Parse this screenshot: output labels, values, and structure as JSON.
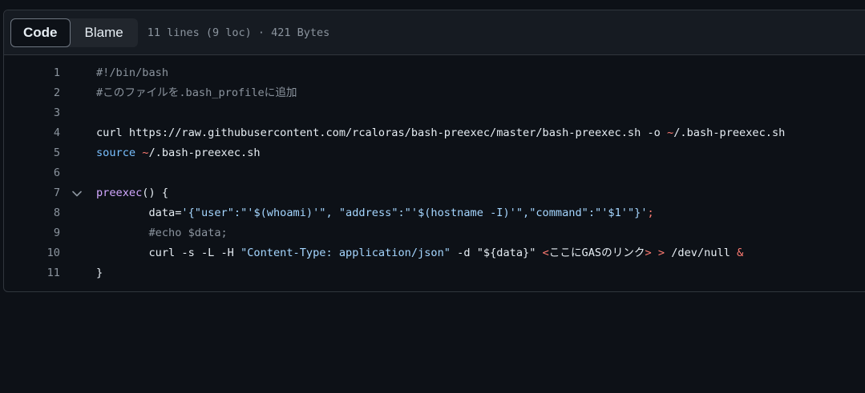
{
  "header": {
    "code_label": "Code",
    "blame_label": "Blame",
    "meta": "11 lines (9 loc) · 421 Bytes"
  },
  "colors": {
    "background": "#0d1117",
    "header_background": "#161b22",
    "border": "#30363d",
    "comment": "#8b949e",
    "string": "#a5d6ff",
    "builtin": "#79c0ff",
    "function": "#d2a8ff",
    "operator": "#ff7b72",
    "text": "#e6edf3"
  },
  "icons": {
    "fold": "chevron-down-icon"
  },
  "lines": [
    {
      "number": "1",
      "tokens": [
        {
          "t": "#!/bin/bash",
          "c": "comment"
        }
      ]
    },
    {
      "number": "2",
      "tokens": [
        {
          "t": "#このファイルを.bash_profileに追加",
          "c": "comment"
        }
      ]
    },
    {
      "number": "3",
      "tokens": []
    },
    {
      "number": "4",
      "tokens": [
        {
          "t": "curl https://raw.githubusercontent.com/rcaloras/bash-preexec/master/bash-preexec.sh -o ",
          "c": "plain"
        },
        {
          "t": "~",
          "c": "op"
        },
        {
          "t": "/.bash-preexec.sh",
          "c": "plain"
        }
      ]
    },
    {
      "number": "5",
      "tokens": [
        {
          "t": "source",
          "c": "builtin"
        },
        {
          "t": " ",
          "c": "plain"
        },
        {
          "t": "~",
          "c": "op"
        },
        {
          "t": "/.bash-preexec.sh",
          "c": "plain"
        }
      ]
    },
    {
      "number": "6",
      "tokens": []
    },
    {
      "number": "7",
      "fold": true,
      "tokens": [
        {
          "t": "preexec",
          "c": "func"
        },
        {
          "t": "() {",
          "c": "plain"
        }
      ]
    },
    {
      "number": "8",
      "tokens": [
        {
          "t": "        data=",
          "c": "plain"
        },
        {
          "t": "'{\"user\":\"'",
          "c": "string"
        },
        {
          "t": "$(whoami)",
          "c": "string"
        },
        {
          "t": "'\", \"address\":\"'",
          "c": "string"
        },
        {
          "t": "$(hostname -I)",
          "c": "string"
        },
        {
          "t": "'\",\"command\":\"'",
          "c": "string"
        },
        {
          "t": "$1",
          "c": "string"
        },
        {
          "t": "'\"}'",
          "c": "string"
        },
        {
          "t": ";",
          "c": "op"
        }
      ]
    },
    {
      "number": "9",
      "tokens": [
        {
          "t": "        #echo $data;",
          "c": "comment"
        }
      ]
    },
    {
      "number": "10",
      "tokens": [
        {
          "t": "        curl -s -L -H ",
          "c": "plain"
        },
        {
          "t": "\"Content-Type: application/json\"",
          "c": "string"
        },
        {
          "t": " -d ",
          "c": "plain"
        },
        {
          "t": "\"${data}\"",
          "c": "plain"
        },
        {
          "t": " ",
          "c": "plain"
        },
        {
          "t": "<",
          "c": "op"
        },
        {
          "t": "ここにGASのリンク",
          "c": "plain"
        },
        {
          "t": ">",
          "c": "op"
        },
        {
          "t": " ",
          "c": "plain"
        },
        {
          "t": ">",
          "c": "op"
        },
        {
          "t": " /dev/null ",
          "c": "plain"
        },
        {
          "t": "&",
          "c": "op"
        }
      ]
    },
    {
      "number": "11",
      "tokens": [
        {
          "t": "}",
          "c": "plain"
        }
      ]
    }
  ]
}
